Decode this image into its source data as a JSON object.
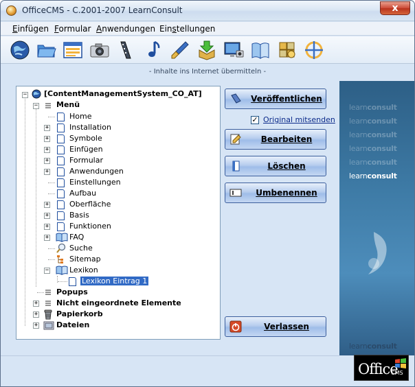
{
  "window": {
    "title": "OfficeCMS - C.2001-2007 LearnConsult",
    "close_glyph": "x"
  },
  "menu": [
    {
      "label": "Einfügen",
      "accel": "E"
    },
    {
      "label": "Formular",
      "accel": "F"
    },
    {
      "label": "Anwendungen",
      "accel": "A"
    },
    {
      "label": "Einstellungen",
      "accel": "s"
    }
  ],
  "toolbar_icons": [
    "globe-icon",
    "folder-icon",
    "list-window-icon",
    "camera-icon",
    "film-icon",
    "music-note-icon",
    "paint-brush-icon",
    "download-box-icon",
    "monitor-icon",
    "book-icon",
    "puzzle-icon",
    "crosshair-icon"
  ],
  "caption": "- Inhalte ins Internet übermitteln -",
  "tree": {
    "root": "[ContentManagementSystem_CO_AT]",
    "menu_label": "Menü",
    "menu_items": [
      "Home",
      "Installation",
      "Symbole",
      "Einfügen",
      "Formular",
      "Anwendungen",
      "Einstellungen",
      "Aufbau",
      "Oberfläche",
      "Basis",
      "Funktionen",
      "FAQ",
      "Suche",
      "Sitemap",
      "Lexikon"
    ],
    "lexikon_child": "Lexikon Eintrag 1",
    "top_level": [
      "Popups",
      "Nicht eingeordnete Elemente",
      "Papierkorb",
      "Dateien"
    ],
    "expand_glyph": "+",
    "collapse_glyph": "−"
  },
  "actions": {
    "publish": "Veröffentlichen",
    "send_original": "Original mitsenden",
    "send_original_checked": "✓",
    "edit": "Bearbeiten",
    "delete": "Löschen",
    "rename": "Umbenennen",
    "quit": "Verlassen"
  },
  "brand": {
    "word_light": "learn",
    "word_bold": "consult",
    "logo_main": "Office",
    "logo_sub": "CMS"
  },
  "colors": {
    "accent": "#316ac5",
    "brand_panel": "#3e7ba6"
  }
}
